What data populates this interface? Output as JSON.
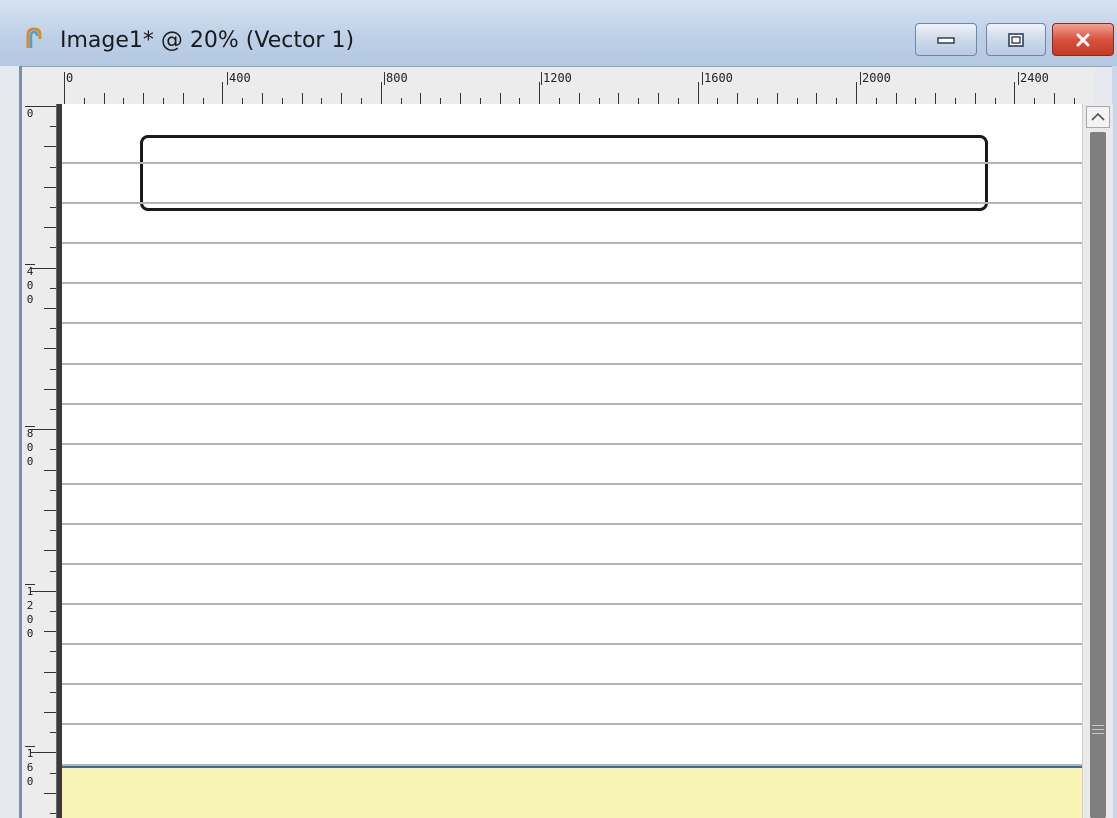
{
  "window": {
    "title": "Image1* @  20% (Vector 1)",
    "icon": "paint-shop-pro-icon",
    "controls": [
      "minimize-icon",
      "maximize-icon",
      "close-icon"
    ]
  },
  "ruler_top": {
    "labels": [
      "0",
      "400",
      "800",
      "1200",
      "1600",
      "2000",
      "2400"
    ]
  },
  "ruler_left": {
    "labels": [
      "0",
      "400",
      "800",
      "1200",
      "160"
    ]
  },
  "colors": {
    "title_bar": "#bccfe6",
    "close_button": "#d8523e",
    "yellow_area": "#f7f4b4",
    "shape_stroke": "#1a1a1a",
    "guide_lines": "#b5b5b5"
  }
}
